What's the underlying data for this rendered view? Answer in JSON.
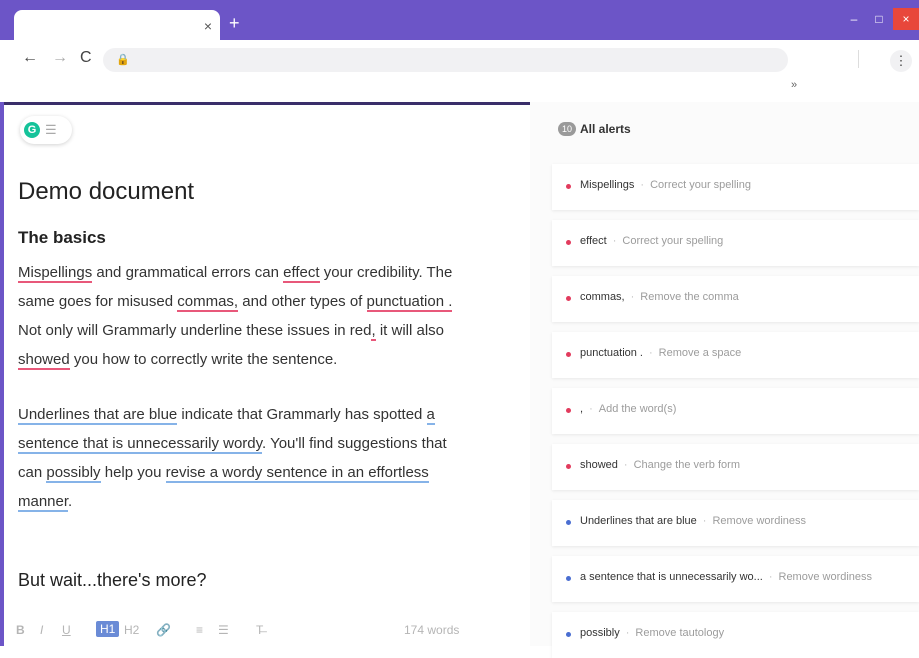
{
  "browser": {
    "tab_close": "×",
    "new_tab": "+",
    "nav": {
      "back": "←",
      "forward": "→",
      "reload": "C"
    },
    "lock": "🔒",
    "menu": "⋮",
    "extensions": "»",
    "window": {
      "minimize": "–",
      "maximize": "□",
      "close": "×"
    }
  },
  "editor": {
    "doc_title": "Demo document",
    "section1_heading": "The basics",
    "para1": [
      [
        {
          "t": "Mispellings",
          "u": "r"
        },
        {
          "t": " and grammatical errors can "
        },
        {
          "t": "effect",
          "u": "r"
        },
        {
          "t": " your credibility. The"
        }
      ],
      [
        {
          "t": "same goes for misused "
        },
        {
          "t": "commas,",
          "u": "r"
        },
        {
          "t": " and other types of "
        },
        {
          "t": "punctuation .",
          "u": "r"
        }
      ],
      [
        {
          "t": "Not only will Grammarly underline these issues in red"
        },
        {
          "t": ",",
          "u": "r"
        },
        {
          "t": " it will also"
        }
      ],
      [
        {
          "t": "showed",
          "u": "r"
        },
        {
          "t": " you how to correctly write the sentence."
        }
      ]
    ],
    "para2": [
      [
        {
          "t": "Underlines that are blue",
          "u": "b"
        },
        {
          "t": " indicate that Grammarly has spotted "
        },
        {
          "t": "a",
          "u": "b"
        }
      ],
      [
        {
          "t": "sentence that is unnecessarily wordy",
          "u": "b"
        },
        {
          "t": ". You'll find suggestions that"
        }
      ],
      [
        {
          "t": "can "
        },
        {
          "t": "possibly",
          "u": "b"
        },
        {
          "t": " help you "
        },
        {
          "t": "revise a wordy sentence in an effortless",
          "u": "b"
        }
      ],
      [
        {
          "t": "manner",
          "u": "b"
        },
        {
          "t": "."
        }
      ]
    ],
    "section2_heading": "But wait...there's more?",
    "format_bar": {
      "bold": "B",
      "italic": "I",
      "underline": "U",
      "h1": "H1",
      "h2": "H2",
      "link": "🔗",
      "ordered_list": "≡",
      "bullet_list": "☰",
      "clear": "T̶",
      "word_count": "174 words"
    }
  },
  "alerts": {
    "count": "10",
    "title": "All alerts",
    "items": [
      {
        "term": "Mispellings",
        "hint": "Correct your spelling",
        "color": "red"
      },
      {
        "term": "effect",
        "hint": "Correct your spelling",
        "color": "red"
      },
      {
        "term": "commas,",
        "hint": "Remove the comma",
        "color": "red"
      },
      {
        "term": "punctuation .",
        "hint": "Remove a space",
        "color": "red"
      },
      {
        "term": ",",
        "hint": "Add the word(s)",
        "color": "red"
      },
      {
        "term": "showed",
        "hint": "Change the verb form",
        "color": "red"
      },
      {
        "term": "Underlines that are blue",
        "hint": "Remove wordiness",
        "color": "blue"
      },
      {
        "term": "a sentence that is unnecessarily wo...",
        "hint": "Remove wordiness",
        "color": "blue"
      },
      {
        "term": "possibly",
        "hint": "Remove tautology",
        "color": "blue"
      }
    ]
  },
  "colors": {
    "accent": "#6c55c7",
    "grammarly_green": "#15c39a",
    "error_red": "#e23b5d",
    "clarity_blue": "#4a6ed1"
  }
}
